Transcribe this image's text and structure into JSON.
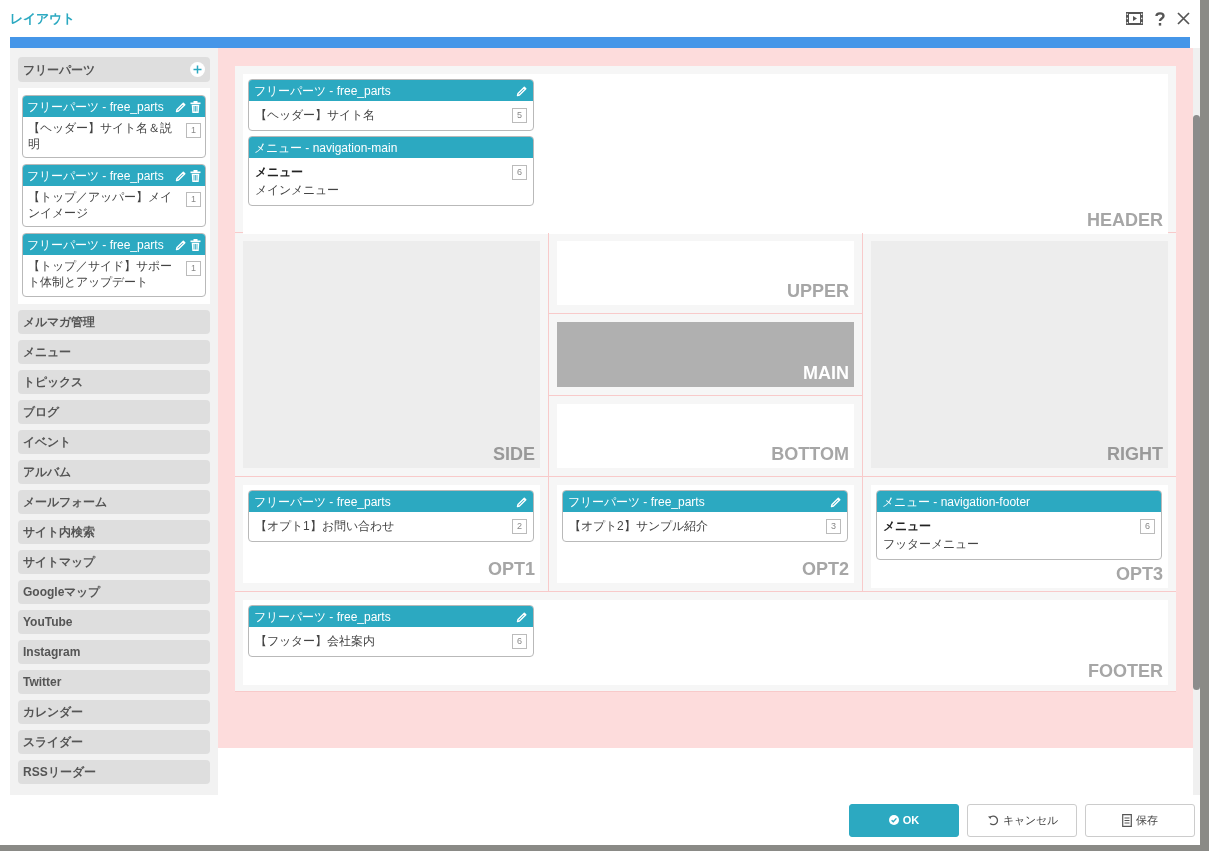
{
  "window": {
    "title": "レイアウト"
  },
  "sidebar": {
    "group": {
      "label": "フリーパーツ",
      "cards": [
        {
          "header": "フリーパーツ - free_parts",
          "text": "【ヘッダー】サイト名＆説明",
          "number": "1",
          "editable": true,
          "deletable": true
        },
        {
          "header": "フリーパーツ - free_parts",
          "text": "【トップ／アッパー】メインイメージ",
          "number": "1",
          "editable": true,
          "deletable": true
        },
        {
          "header": "フリーパーツ - free_parts",
          "text": "【トップ／サイド】サポート体制とアップデート",
          "number": "1",
          "editable": true,
          "deletable": true
        }
      ]
    },
    "items": [
      {
        "label": "メルマガ管理"
      },
      {
        "label": "メニュー"
      },
      {
        "label": "トピックス"
      },
      {
        "label": "ブログ"
      },
      {
        "label": "イベント"
      },
      {
        "label": "アルバム"
      },
      {
        "label": "メールフォーム"
      },
      {
        "label": "サイト内検索"
      },
      {
        "label": "サイトマップ"
      },
      {
        "label": "Googleマップ"
      },
      {
        "label": "YouTube"
      },
      {
        "label": "Instagram"
      },
      {
        "label": "Twitter"
      },
      {
        "label": "カレンダー"
      },
      {
        "label": "スライダー"
      },
      {
        "label": "RSSリーダー"
      }
    ]
  },
  "layout": {
    "rows": [
      {
        "cells": [
          {
            "zones": [
              {
                "label": "HEADER",
                "kind": "blank",
                "cards": [
                  {
                    "header": "フリーパーツ - free_parts",
                    "text": "【ヘッダー】サイト名",
                    "number": "5",
                    "editable": true,
                    "deletable": false
                  },
                  {
                    "header": "メニュー - navigation-main",
                    "title": "メニュー",
                    "text": "メインメニュー",
                    "number": "6",
                    "editable": false,
                    "deletable": false
                  }
                ]
              }
            ]
          }
        ]
      },
      {
        "cells": [
          {
            "zones": [
              {
                "label": "SIDE",
                "kind": "gray"
              }
            ]
          },
          {
            "zones": [
              {
                "label": "UPPER",
                "kind": "blank"
              },
              {
                "label": "MAIN",
                "kind": "dark"
              },
              {
                "label": "BOTTOM",
                "kind": "blank"
              }
            ]
          },
          {
            "zones": [
              {
                "label": "RIGHT",
                "kind": "gray"
              }
            ]
          }
        ]
      },
      {
        "cells": [
          {
            "zones": [
              {
                "label": "OPT1",
                "kind": "blank",
                "cards": [
                  {
                    "header": "フリーパーツ - free_parts",
                    "text": "【オプト1】お問い合わせ",
                    "number": "2",
                    "editable": true,
                    "deletable": false
                  }
                ]
              }
            ]
          },
          {
            "zones": [
              {
                "label": "OPT2",
                "kind": "blank",
                "cards": [
                  {
                    "header": "フリーパーツ - free_parts",
                    "text": "【オプト2】サンプル紹介",
                    "number": "3",
                    "editable": true,
                    "deletable": false
                  }
                ]
              }
            ]
          },
          {
            "zones": [
              {
                "label": "OPT3",
                "kind": "blank",
                "cards": [
                  {
                    "header": "メニュー - navigation-footer",
                    "title": "メニュー",
                    "text": "フッターメニュー",
                    "number": "6",
                    "editable": false,
                    "deletable": false
                  }
                ]
              }
            ]
          }
        ]
      },
      {
        "cells": [
          {
            "zones": [
              {
                "label": "FOOTER",
                "kind": "blank",
                "cards": [
                  {
                    "header": "フリーパーツ - free_parts",
                    "text": "【フッター】会社案内",
                    "number": "6",
                    "editable": true,
                    "deletable": false
                  }
                ]
              }
            ]
          }
        ]
      }
    ]
  },
  "buttons": [
    {
      "label": "OK",
      "kind": "ok"
    },
    {
      "label": "キャンセル",
      "kind": "cancel"
    },
    {
      "label": "保存",
      "kind": "save"
    }
  ]
}
